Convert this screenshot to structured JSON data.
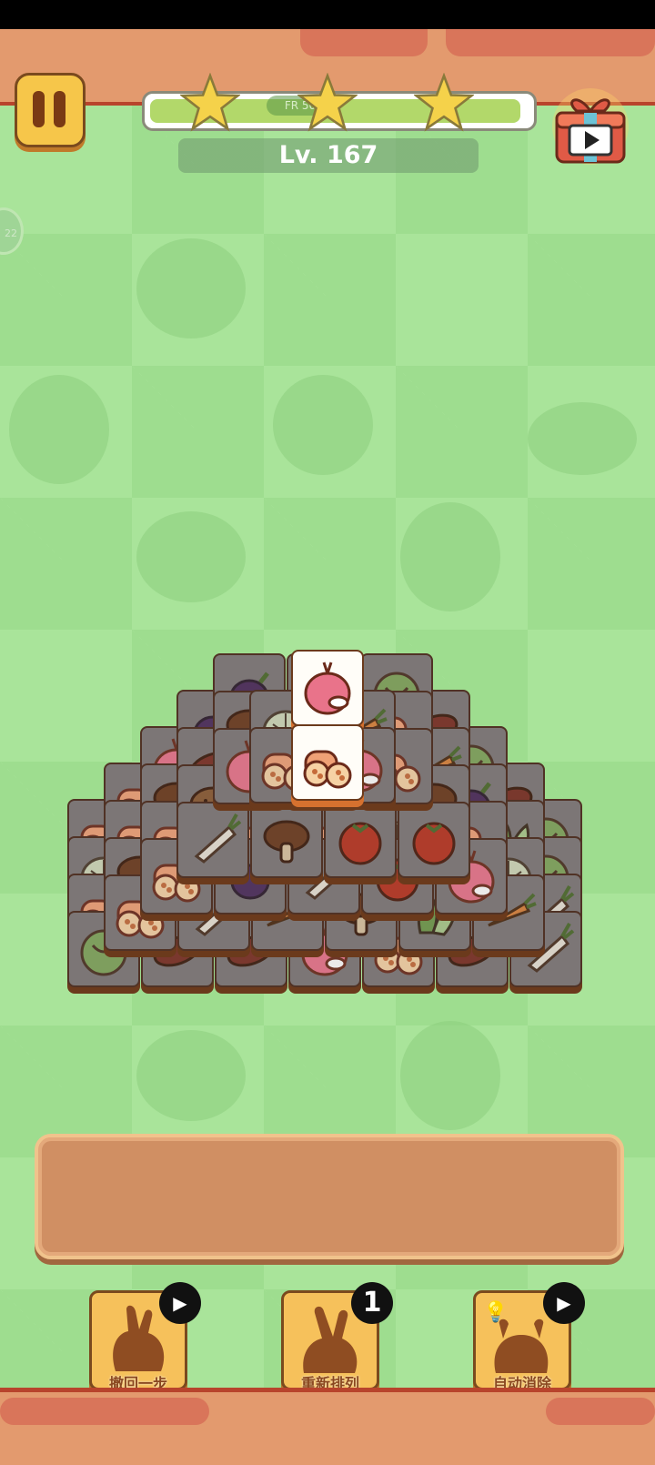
{
  "header": {
    "level_label": "Lv. 167",
    "progress_pill_text": "FR 50",
    "stars": 3,
    "progress": 0.98
  },
  "tools": [
    {
      "label": "撤回一步",
      "badge_type": "video"
    },
    {
      "label": "重新排列",
      "badge_type": "count",
      "badge_text": "1"
    },
    {
      "label": "自动消除",
      "badge_type": "video"
    }
  ],
  "side_badge_text": "22",
  "board": {
    "top_tiles": [
      "onion",
      "lotus-root"
    ],
    "tile_types": [
      "lettuce",
      "onion",
      "radish",
      "eggplant",
      "mushroom",
      "lotus-root",
      "potato",
      "carrot",
      "tomato",
      "bok-choy",
      "cabbage",
      "sweet-potato"
    ]
  },
  "colors": {
    "accent": "#f6c15b",
    "background": "#a9e49a",
    "tray": "#d08f63",
    "banner": "#e39a6e"
  }
}
